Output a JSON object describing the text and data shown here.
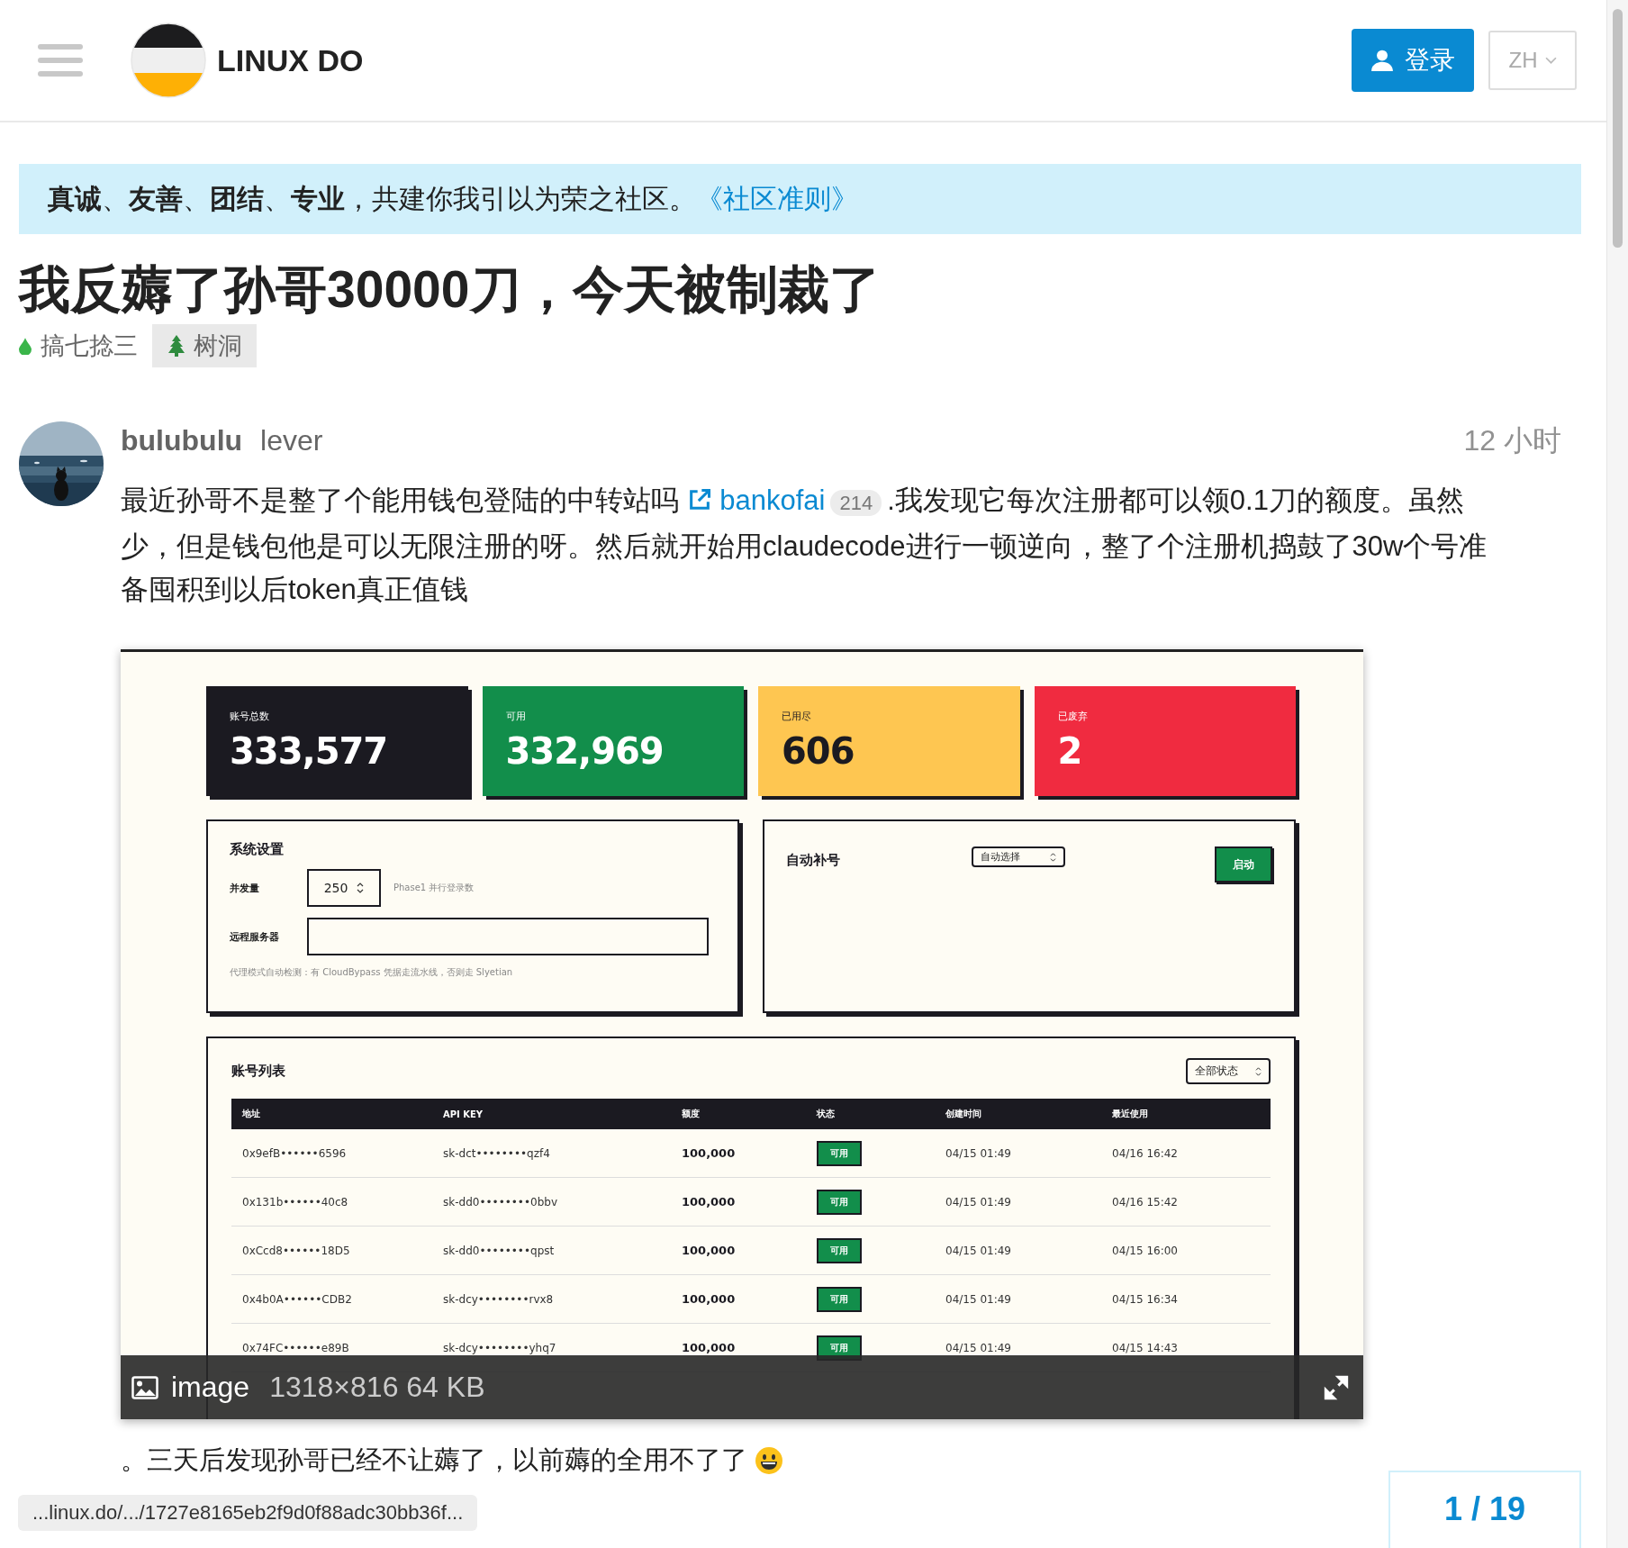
{
  "header": {
    "brand": "LINUX DO",
    "login_button": "登录",
    "language": "ZH"
  },
  "banner": {
    "text": "**真诚**、**友善**、**团结**、**专业**，共建你我引以为荣之社区。",
    "link": "《社区准则》"
  },
  "topic": {
    "title": "我反薅了孙哥30000刀，今天被制裁了",
    "category": {
      "name": "搞七捻三",
      "color": "#3ab54a"
    },
    "tags": [
      "树洞"
    ]
  },
  "post": {
    "username": "bulubulu",
    "user_title": "lever",
    "time": "12 小时",
    "body_before": "最近孙哥不是整了个能用钱包登陆的中转站吗",
    "link": {
      "text": "bankofai",
      "clicks": "214"
    },
    "body_after": ".我发现它每次注册都可以领0.1刀的额度。虽然少，但是钱包他是可以无限注册的呀。然后就开始用claudecode进行一顿逆向，整了个注册机捣鼓了30w个号准备囤积到以后token真正值钱",
    "image": {
      "stats": [
        {
          "label": "账号总数",
          "value": "333,577",
          "color": "#1b1a21"
        },
        {
          "label": "可用",
          "value": "332,969",
          "color": "#128e4b"
        },
        {
          "label": "已用尽",
          "value": "606",
          "color": "#fec651"
        },
        {
          "label": "已废弃",
          "value": "2",
          "color": "#f02b40"
        }
      ],
      "settings": {
        "title": "系统设置",
        "concurrency_label": "并发量",
        "concurrency": "250",
        "concurrency_hint": "Phase1 并行登录数",
        "remote_label": "远程服务器",
        "note": "代理模式自动检测：有 CloudBypass 凭据走流水线，否则走 Slyetian"
      },
      "auto": {
        "title": "自动补号",
        "select": "自动选择",
        "button": "启动"
      },
      "accounts": {
        "title": "账号列表",
        "filter": "全部状态",
        "columns": [
          "地址",
          "API KEY",
          "额度",
          "状态",
          "创建时间",
          "最近使用"
        ],
        "rows": [
          {
            "address": "0x9efB••••••6596",
            "api_key": "sk-dct••••••••qzf4",
            "quota": "100,000",
            "status": "可用",
            "created": "04/15 01:49",
            "last_used": "04/16 16:42"
          },
          {
            "address": "0x131b••••••40c8",
            "api_key": "sk-dd0••••••••0bbv",
            "quota": "100,000",
            "status": "可用",
            "created": "04/15 01:49",
            "last_used": "04/16 15:42"
          },
          {
            "address": "0xCcd8••••••18D5",
            "api_key": "sk-dd0••••••••qpst",
            "quota": "100,000",
            "status": "可用",
            "created": "04/15 01:49",
            "last_used": "04/15 16:00"
          },
          {
            "address": "0x4b0A••••••CDB2",
            "api_key": "sk-dcy••••••••rvx8",
            "quota": "100,000",
            "status": "可用",
            "created": "04/15 01:49",
            "last_used": "04/15 16:34"
          },
          {
            "address": "0x74FC••••••e89B",
            "api_key": "sk-dcy••••••••yhq7",
            "quota": "100,000",
            "status": "可用",
            "created": "04/15 01:49",
            "last_used": "04/15 14:43"
          }
        ]
      },
      "caption": {
        "name": "image",
        "meta": "1318×816 64 KB"
      }
    },
    "closing_text": "。三天后发现孙哥已经不让薅了，以前薅的全用不了了"
  },
  "status_url": "...linux.do/.../1727e8165eb2f9d0f88adc30bb36f...",
  "progress": "1 / 19"
}
